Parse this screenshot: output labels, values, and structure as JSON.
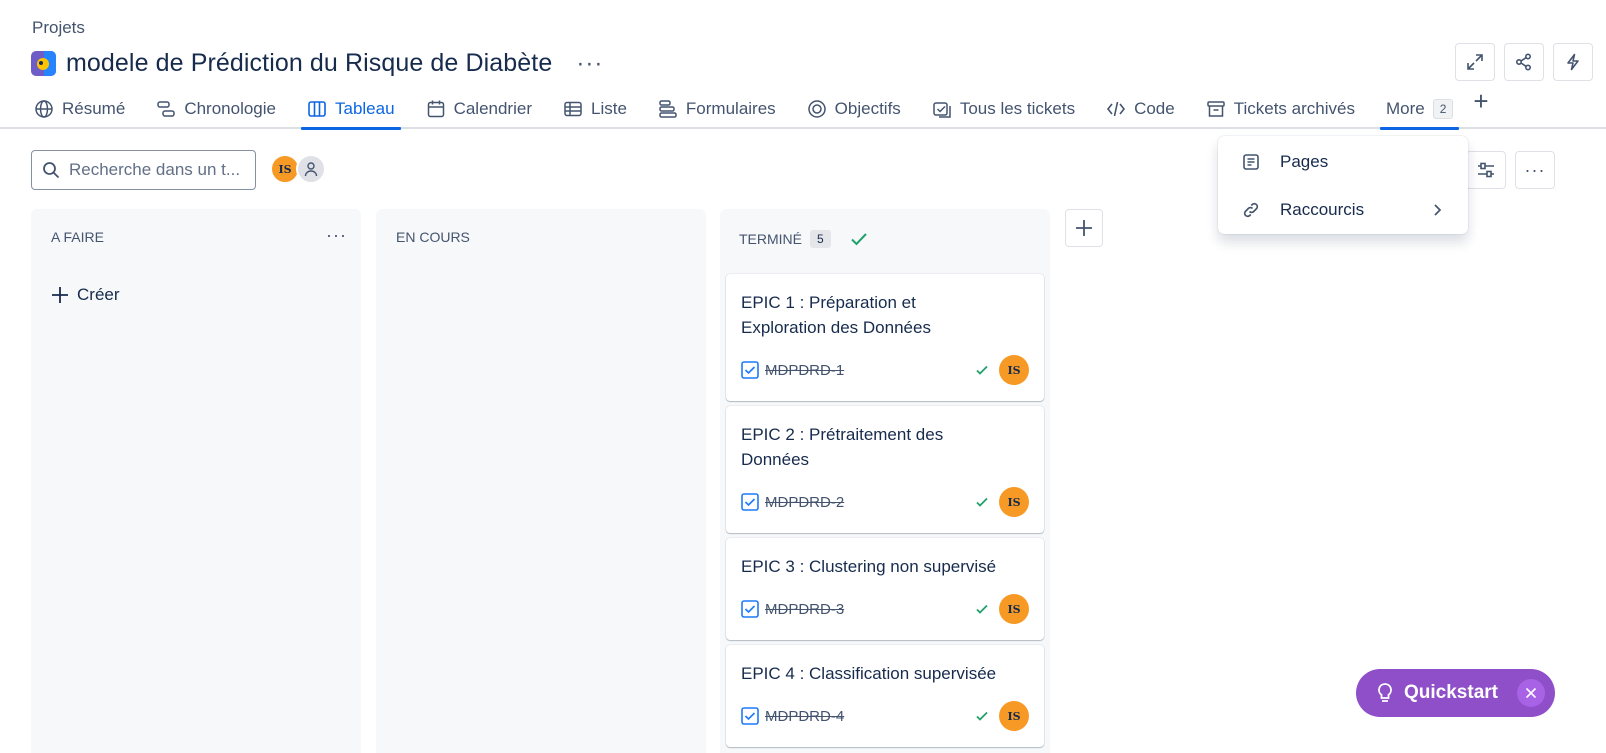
{
  "breadcrumb": "Projets",
  "project": {
    "title": "modele de Prédiction du Risque de Diabète",
    "more": "···"
  },
  "tabs": [
    {
      "label": "Résumé",
      "icon": "globe-icon"
    },
    {
      "label": "Chronologie",
      "icon": "timeline-icon"
    },
    {
      "label": "Tableau",
      "icon": "board-icon",
      "active": true
    },
    {
      "label": "Calendrier",
      "icon": "calendar-icon"
    },
    {
      "label": "Liste",
      "icon": "list-icon"
    },
    {
      "label": "Formulaires",
      "icon": "forms-icon"
    },
    {
      "label": "Objectifs",
      "icon": "target-icon"
    },
    {
      "label": "Tous les tickets",
      "icon": "tickets-icon"
    },
    {
      "label": "Code",
      "icon": "code-icon"
    },
    {
      "label": "Tickets archivés",
      "icon": "archive-icon"
    }
  ],
  "tab_more": {
    "label": "More",
    "count": "2"
  },
  "search": {
    "placeholder": "Recherche dans un t..."
  },
  "assignee_initials": "IS",
  "columns": [
    {
      "title": "A FAIRE",
      "create_label": "Créer"
    },
    {
      "title": "EN COURS"
    },
    {
      "title": "TERMINÉ",
      "count": "5"
    }
  ],
  "cards": [
    {
      "title": "EPIC 1 : Préparation et Exploration des Données",
      "key": "MDPDRD-1",
      "assignee": "IS"
    },
    {
      "title": "EPIC 2 : Prétraitement des Données",
      "key": "MDPDRD-2",
      "assignee": "IS"
    },
    {
      "title": "EPIC 3 : Clustering non supervisé",
      "key": "MDPDRD-3",
      "assignee": "IS"
    },
    {
      "title": "EPIC 4 : Classification supervisée",
      "key": "MDPDRD-4",
      "assignee": "IS"
    }
  ],
  "more_menu": [
    {
      "label": "Pages",
      "icon": "page-icon"
    },
    {
      "label": "Raccourcis",
      "icon": "link-icon"
    }
  ],
  "quickstart": {
    "label": "Quickstart"
  },
  "colors": {
    "accent": "#0c66e4",
    "avatar": "#f79a25",
    "quickstart": "#8f4fc8",
    "done_check": "#22a06b"
  }
}
